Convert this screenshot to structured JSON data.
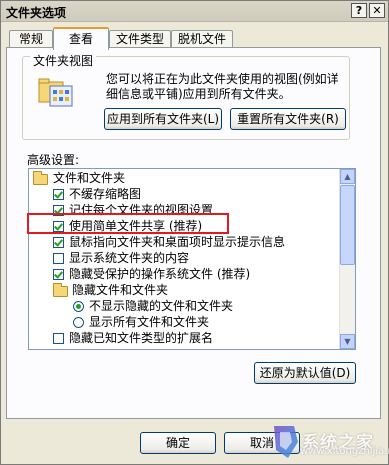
{
  "window": {
    "title": "文件夹选项",
    "help_label": "?",
    "close_label": "✕"
  },
  "tabs": [
    {
      "label": "常规"
    },
    {
      "label": "查看"
    },
    {
      "label": "文件类型"
    },
    {
      "label": "脱机文件"
    }
  ],
  "folder_view": {
    "legend": "文件夹视图",
    "description": "您可以将正在为此文件夹使用的视图(例如详细信息或平铺)应用到所有文件夹。",
    "apply_all_label": "应用到所有文件夹(L)",
    "reset_all_label": "重置所有文件夹(R)"
  },
  "advanced": {
    "label": "高级设置:",
    "items": [
      {
        "type": "folder",
        "label": "文件和文件夹"
      },
      {
        "type": "checkbox",
        "checked": true,
        "label": "不缓存缩略图"
      },
      {
        "type": "checkbox",
        "checked": true,
        "label": "记住每个文件夹的视图设置"
      },
      {
        "type": "checkbox",
        "checked": true,
        "label": "使用简单文件共享 (推荐)"
      },
      {
        "type": "checkbox",
        "checked": true,
        "label": "鼠标指向文件夹和桌面项时显示提示信息"
      },
      {
        "type": "checkbox",
        "checked": false,
        "label": "显示系统文件夹的内容"
      },
      {
        "type": "checkbox",
        "checked": true,
        "label": "隐藏受保护的操作系统文件 (推荐)"
      },
      {
        "type": "folder",
        "label": "隐藏文件和文件夹"
      },
      {
        "type": "radio",
        "checked": true,
        "label": "不显示隐藏的文件和文件夹"
      },
      {
        "type": "radio",
        "checked": false,
        "label": "显示所有文件和文件夹"
      },
      {
        "type": "checkbox",
        "checked": false,
        "label": "隐藏已知文件类型的扩展名"
      }
    ],
    "restore_defaults_label": "还原为默认值(D)"
  },
  "footer": {
    "ok_label": "确定",
    "cancel_label": "取消"
  },
  "watermark": {
    "text": "系统之家",
    "url": "www.xitongzhijia.net"
  },
  "colors": {
    "highlight_box": "#e3191f",
    "check": "#21a121"
  }
}
